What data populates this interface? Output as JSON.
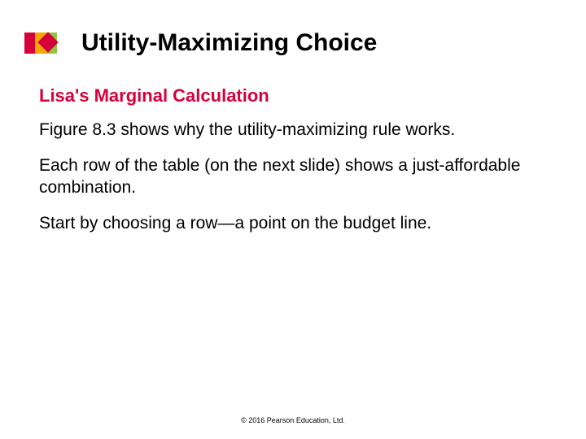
{
  "title": "Utility-Maximizing Choice",
  "subhead": "Lisa's Marginal Calculation",
  "paragraphs": {
    "p1": "Figure 8.3 shows why the utility-maximizing rule works.",
    "p2": "Each row of the table (on the next slide) shows a just-affordable combination.",
    "p3": "Start by choosing a row—a point on the budget line."
  },
  "footer": "© 2016 Pearson Education, Ltd."
}
